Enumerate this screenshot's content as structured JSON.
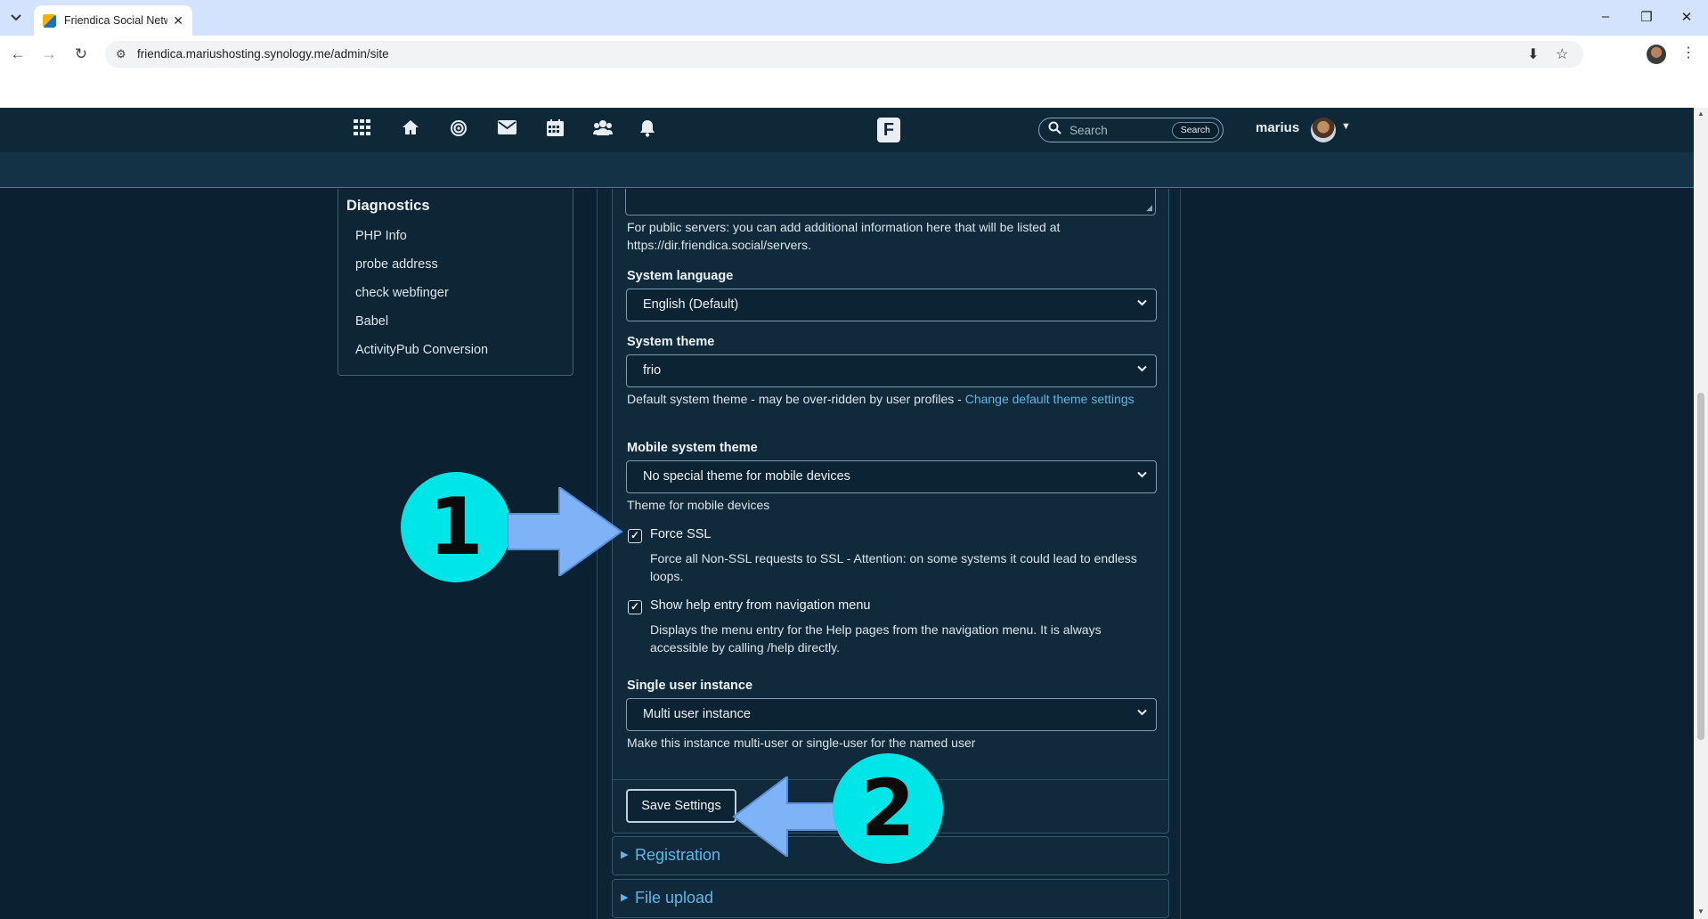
{
  "browser": {
    "tab_title": "Friendica Social Netw",
    "tab_close": "✕",
    "url": "friendica.mariushosting.synology.me/admin/site",
    "window_controls": [
      "–",
      "❐",
      "✕"
    ]
  },
  "header": {
    "nav_icons": [
      "apps-grid-icon",
      "home-icon",
      "network-icon",
      "mail-icon",
      "calendar-icon",
      "contacts-icon",
      "notifications-icon"
    ],
    "brand_letter": "F",
    "search_placeholder": "Search",
    "search_button": "Search",
    "username": "marius"
  },
  "sidebar": {
    "title": "Diagnostics",
    "items": [
      "PHP Info",
      "probe address",
      "check webfinger",
      "Babel",
      "ActivityPub Conversion"
    ]
  },
  "form": {
    "info_help": "For public servers: you can add additional information here that will be listed at https://dir.friendica.social/servers.",
    "language_label": "System language",
    "language_value": "English (Default)",
    "theme_label": "System theme",
    "theme_value": "frio",
    "theme_help_prefix": "Default system theme - may be over-ridden by user profiles - ",
    "theme_help_link": "Change default theme settings",
    "mobile_theme_label": "Mobile system theme",
    "mobile_theme_value": "No special theme for mobile devices",
    "mobile_theme_help": "Theme for mobile devices",
    "force_ssl_label": "Force SSL",
    "force_ssl_checked": true,
    "force_ssl_help": "Force all Non-SSL requests to SSL - Attention: on some systems it could lead to endless loops.",
    "show_help_label": "Show help entry from navigation menu",
    "show_help_checked": true,
    "show_help_help": "Displays the menu entry for the Help pages from the navigation menu. It is always accessible by calling /help directly.",
    "single_user_label": "Single user instance",
    "single_user_value": "Multi user instance",
    "single_user_help": "Make this instance multi-user or single-user for the named user",
    "save_button": "Save Settings",
    "check_mark": "✓"
  },
  "accordions": [
    "Registration",
    "File upload"
  ],
  "annotations": {
    "step1": "1",
    "step2": "2",
    "badge_color": "#00e5e8",
    "arrow_color": "#7eb3f7"
  }
}
